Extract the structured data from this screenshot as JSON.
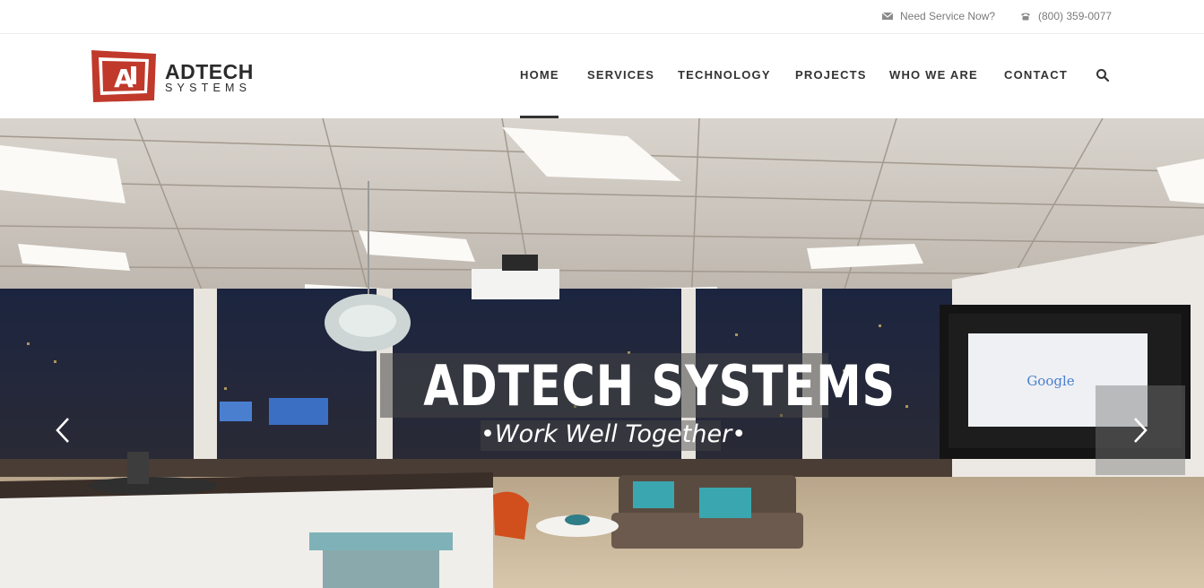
{
  "topbar": {
    "service_label": "Need Service Now?",
    "phone_label": "(800) 359-0077",
    "service_icon": "envelope-icon",
    "phone_icon": "phone-icon"
  },
  "brand": {
    "name": "ADTECH",
    "sub": "SYSTEMS",
    "logo_mark": "AJ",
    "color": "#c0392b"
  },
  "nav": {
    "items": [
      {
        "label": "HOME",
        "active": true
      },
      {
        "label": "SERVICES"
      },
      {
        "label": "TECHNOLOGY"
      },
      {
        "label": "PROJECTS"
      },
      {
        "label": "WHO WE ARE"
      },
      {
        "label": "CONTACT"
      }
    ],
    "search_icon": "search-icon"
  },
  "hero": {
    "title": "ADTECH SYSTEMS",
    "subtitle": "•Work Well Together•",
    "screen_text": "Google",
    "prev_icon": "chevron-left-icon",
    "next_icon": "chevron-right-icon"
  }
}
